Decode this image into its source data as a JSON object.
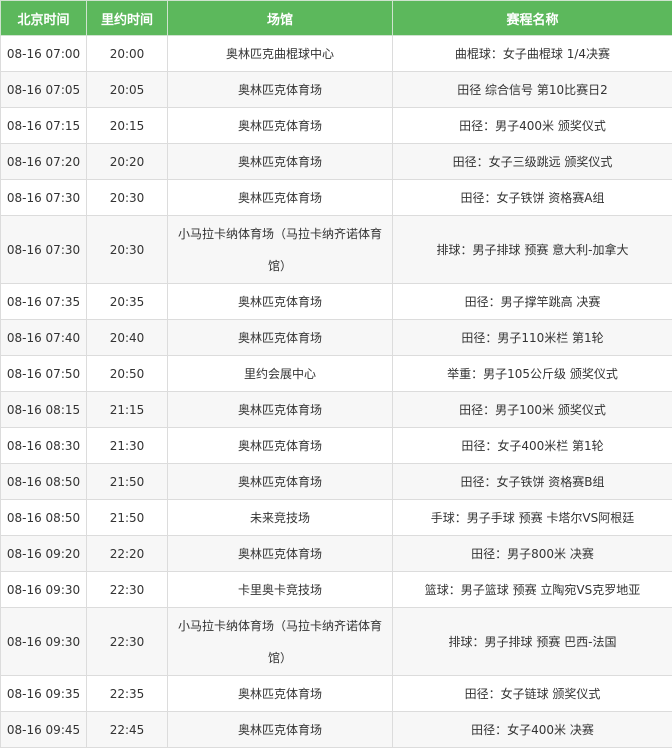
{
  "table": {
    "headers": [
      "北京时间",
      "里约时间",
      "场馆",
      "赛程名称"
    ],
    "rows": [
      {
        "beijing": "08-16 07:00",
        "rio": "20:00",
        "venue": "奥林匹克曲棍球中心",
        "event": "曲棍球：女子曲棍球 1/4决赛"
      },
      {
        "beijing": "08-16 07:05",
        "rio": "20:05",
        "venue": "奥林匹克体育场",
        "event": "田径 综合信号 第10比赛日2"
      },
      {
        "beijing": "08-16 07:15",
        "rio": "20:15",
        "venue": "奥林匹克体育场",
        "event": "田径：男子400米 颁奖仪式"
      },
      {
        "beijing": "08-16 07:20",
        "rio": "20:20",
        "venue": "奥林匹克体育场",
        "event": "田径：女子三级跳远 颁奖仪式"
      },
      {
        "beijing": "08-16 07:30",
        "rio": "20:30",
        "venue": "奥林匹克体育场",
        "event": "田径：女子铁饼 资格赛A组"
      },
      {
        "beijing": "08-16 07:30",
        "rio": "20:30",
        "venue": "小马拉卡纳体育场（马拉卡纳齐诺体育馆）",
        "event": "排球：男子排球 预赛 意大利-加拿大",
        "tall": true
      },
      {
        "beijing": "08-16 07:35",
        "rio": "20:35",
        "venue": "奥林匹克体育场",
        "event": "田径：男子撑竿跳高 决赛"
      },
      {
        "beijing": "08-16 07:40",
        "rio": "20:40",
        "venue": "奥林匹克体育场",
        "event": "田径：男子110米栏 第1轮"
      },
      {
        "beijing": "08-16 07:50",
        "rio": "20:50",
        "venue": "里约会展中心",
        "event": "举重：男子105公斤级 颁奖仪式"
      },
      {
        "beijing": "08-16 08:15",
        "rio": "21:15",
        "venue": "奥林匹克体育场",
        "event": "田径：男子100米 颁奖仪式"
      },
      {
        "beijing": "08-16 08:30",
        "rio": "21:30",
        "venue": "奥林匹克体育场",
        "event": "田径：女子400米栏 第1轮"
      },
      {
        "beijing": "08-16 08:50",
        "rio": "21:50",
        "venue": "奥林匹克体育场",
        "event": "田径：女子铁饼 资格赛B组"
      },
      {
        "beijing": "08-16 08:50",
        "rio": "21:50",
        "venue": "未来竞技场",
        "event": "手球：男子手球 预赛 卡塔尔VS阿根廷"
      },
      {
        "beijing": "08-16 09:20",
        "rio": "22:20",
        "venue": "奥林匹克体育场",
        "event": "田径：男子800米 决赛"
      },
      {
        "beijing": "08-16 09:30",
        "rio": "22:30",
        "venue": "卡里奥卡竞技场",
        "event": "篮球：男子篮球 预赛 立陶宛VS克罗地亚"
      },
      {
        "beijing": "08-16 09:30",
        "rio": "22:30",
        "venue": "小马拉卡纳体育场（马拉卡纳齐诺体育馆）",
        "event": "排球：男子排球 预赛 巴西-法国",
        "tall": true
      },
      {
        "beijing": "08-16 09:35",
        "rio": "22:35",
        "venue": "奥林匹克体育场",
        "event": "田径：女子链球 颁奖仪式"
      },
      {
        "beijing": "08-16 09:45",
        "rio": "22:45",
        "venue": "奥林匹克体育场",
        "event": "田径：女子400米 决赛"
      }
    ]
  }
}
